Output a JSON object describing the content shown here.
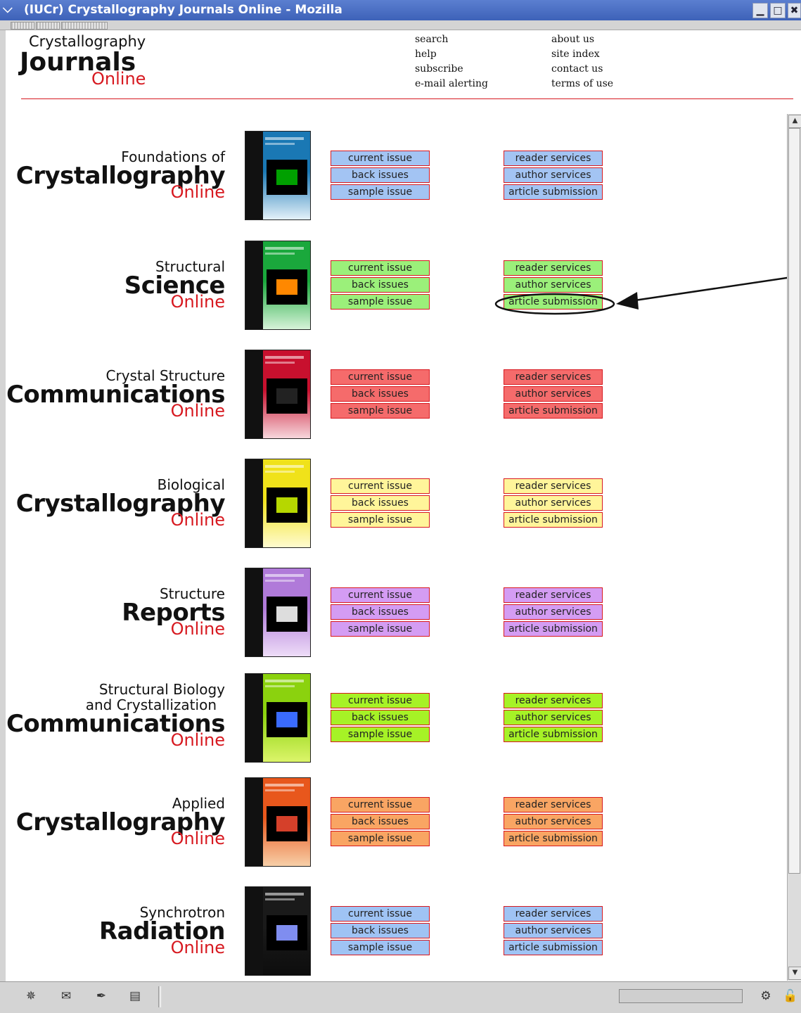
{
  "window": {
    "title": "(IUCr) Crystallography Journals Online - Mozilla",
    "menu_icon": "chevron-down-icon",
    "min_label": "▁",
    "max_label": "□",
    "close_label": "✖"
  },
  "logo": {
    "line1": "Crystallography",
    "line2": "Journals",
    "line3": "Online"
  },
  "nav": {
    "col1": [
      "search",
      "help",
      "subscribe",
      "e-mail alerting"
    ],
    "col2": [
      "about us",
      "site index",
      "contact us",
      "terms of use"
    ]
  },
  "buttons_left": [
    "current issue",
    "back issues",
    "sample issue"
  ],
  "buttons_right": [
    "reader services",
    "author services",
    "article submission"
  ],
  "journals": [
    {
      "small": "Foundations of",
      "big": "Crystallography",
      "online": "Online",
      "color": "#a3c4f3",
      "cover_top": "#1a78b4",
      "cover_bottom": "#e4f1fa",
      "art": "#00a000"
    },
    {
      "small": "Structural",
      "big": "Science",
      "online": "Online",
      "color": "#9bf07a",
      "cover_top": "#1aa83c",
      "cover_bottom": "#d7f3d9",
      "art": "#ff8800"
    },
    {
      "small": "Crystal Structure",
      "big": "Communications",
      "online": "Online",
      "color": "#f56b6b",
      "cover_top": "#c8102e",
      "cover_bottom": "#f7d6dc",
      "art": "#222222"
    },
    {
      "small": "Biological",
      "big": "Crystallography",
      "online": "Online",
      "color": "#fff59a",
      "cover_top": "#f0e21a",
      "cover_bottom": "#fffbd0",
      "art": "#b6d700"
    },
    {
      "small": "Structure",
      "big": "Reports",
      "online": "Online",
      "color": "#d49cf3",
      "cover_top": "#b07ad9",
      "cover_bottom": "#eeddf8",
      "art": "#dddddd"
    },
    {
      "small": "Structural Biology",
      "small2": "and Crystallization",
      "big": "Communications",
      "online": "Online",
      "color": "#a6f226",
      "cover_top": "#8bd20e",
      "cover_bottom": "#dcf56a",
      "art": "#3a6bff"
    },
    {
      "small": "Applied",
      "big": "Crystallography",
      "online": "Online",
      "color": "#f9a563",
      "cover_top": "#e8571c",
      "cover_bottom": "#f7cfa8",
      "art": "#d5402a"
    },
    {
      "small": "Synchrotron",
      "big": "Radiation",
      "online": "Online",
      "color": "#9fc3f4",
      "cover_top": "#1a1a1a",
      "cover_bottom": "#0d0d0d",
      "art": "#7f8df0"
    }
  ],
  "status_icons": [
    "navigator-icon",
    "mail-icon",
    "composer-icon",
    "address-book-icon"
  ],
  "status_right_icons": [
    "connection-icon",
    "security-lock-icon"
  ]
}
